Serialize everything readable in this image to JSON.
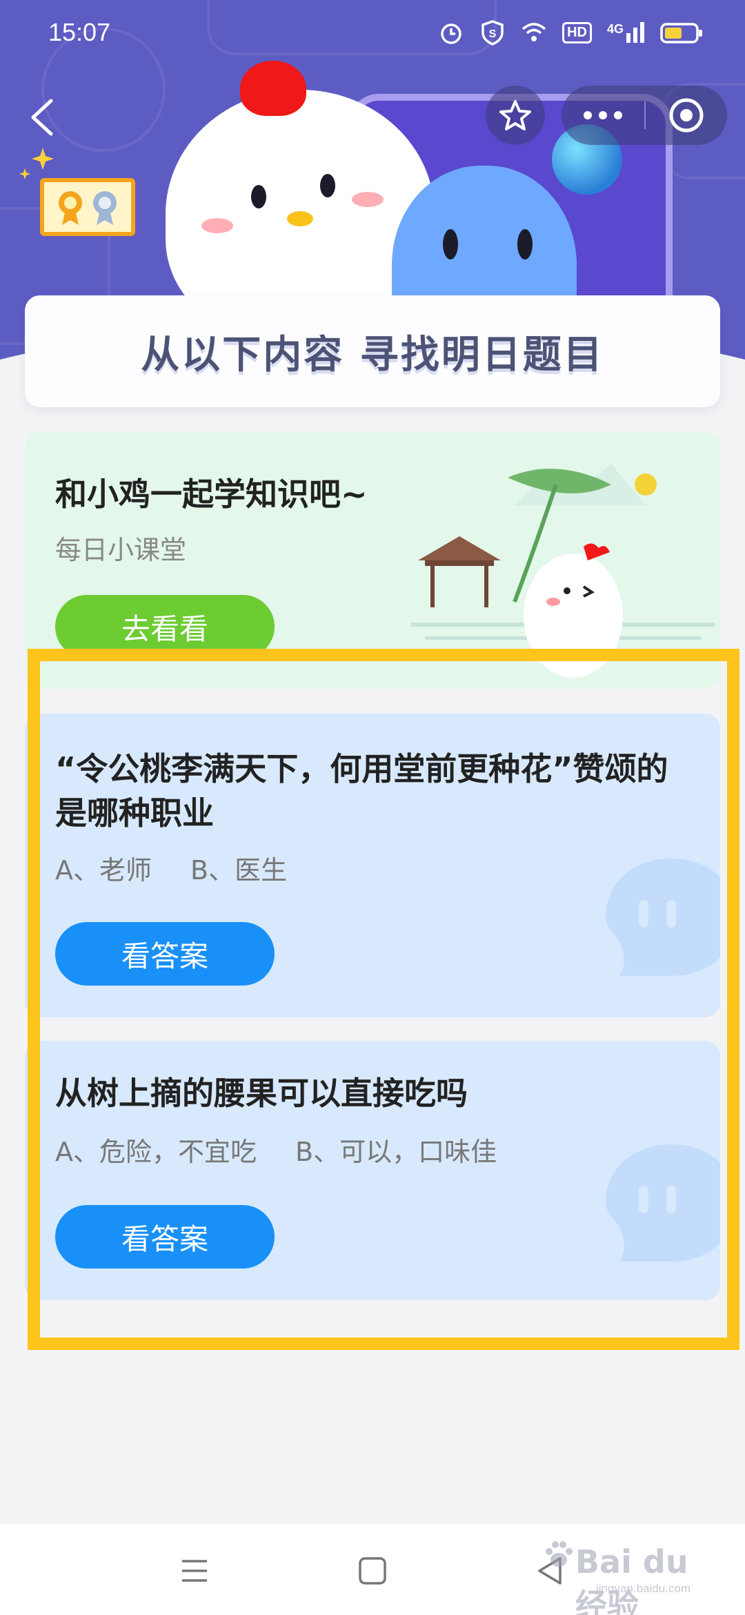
{
  "status_bar": {
    "time": "15:07",
    "icons": [
      "alarm-icon",
      "shield-icon",
      "wifi-icon",
      "hd-icon",
      "signal-4g-icon",
      "battery-icon"
    ],
    "hd_label": "HD",
    "network_label": "4G"
  },
  "header": {
    "back_icon": "chevron-left-icon",
    "capsule": {
      "star_icon": "star-icon",
      "more_icon": "more-dots-icon",
      "close_icon": "target-close-icon"
    }
  },
  "title_banner": {
    "text": "从以下内容  寻找明日题目"
  },
  "lesson_card": {
    "title": "和小鸡一起学知识吧~",
    "subtitle": "每日小课堂",
    "button_label": "去看看"
  },
  "questions": [
    {
      "title": "“令公桃李满天下，何用堂前更种花”赞颂的是哪种职业",
      "options": [
        "A、老师",
        "B、医生"
      ],
      "button_label": "看答案"
    },
    {
      "title": "从树上摘的腰果可以直接吃吗",
      "options": [
        "A、危险，不宜吃",
        "B、可以，口味佳"
      ],
      "button_label": "看答案"
    }
  ],
  "nav_bar": {
    "icons": [
      "menu-icon",
      "home-square-icon",
      "back-triangle-icon"
    ]
  },
  "watermark": {
    "brand": "Bai du 经验",
    "url": "jingyan.baidu.com"
  },
  "colors": {
    "hero": "#5d5cc2",
    "green_button": "#6ccc32",
    "blue_button": "#1890f8",
    "highlight": "#fdc41b",
    "question_card": "#d8e9fd",
    "lesson_card": "#e3f7ea"
  }
}
